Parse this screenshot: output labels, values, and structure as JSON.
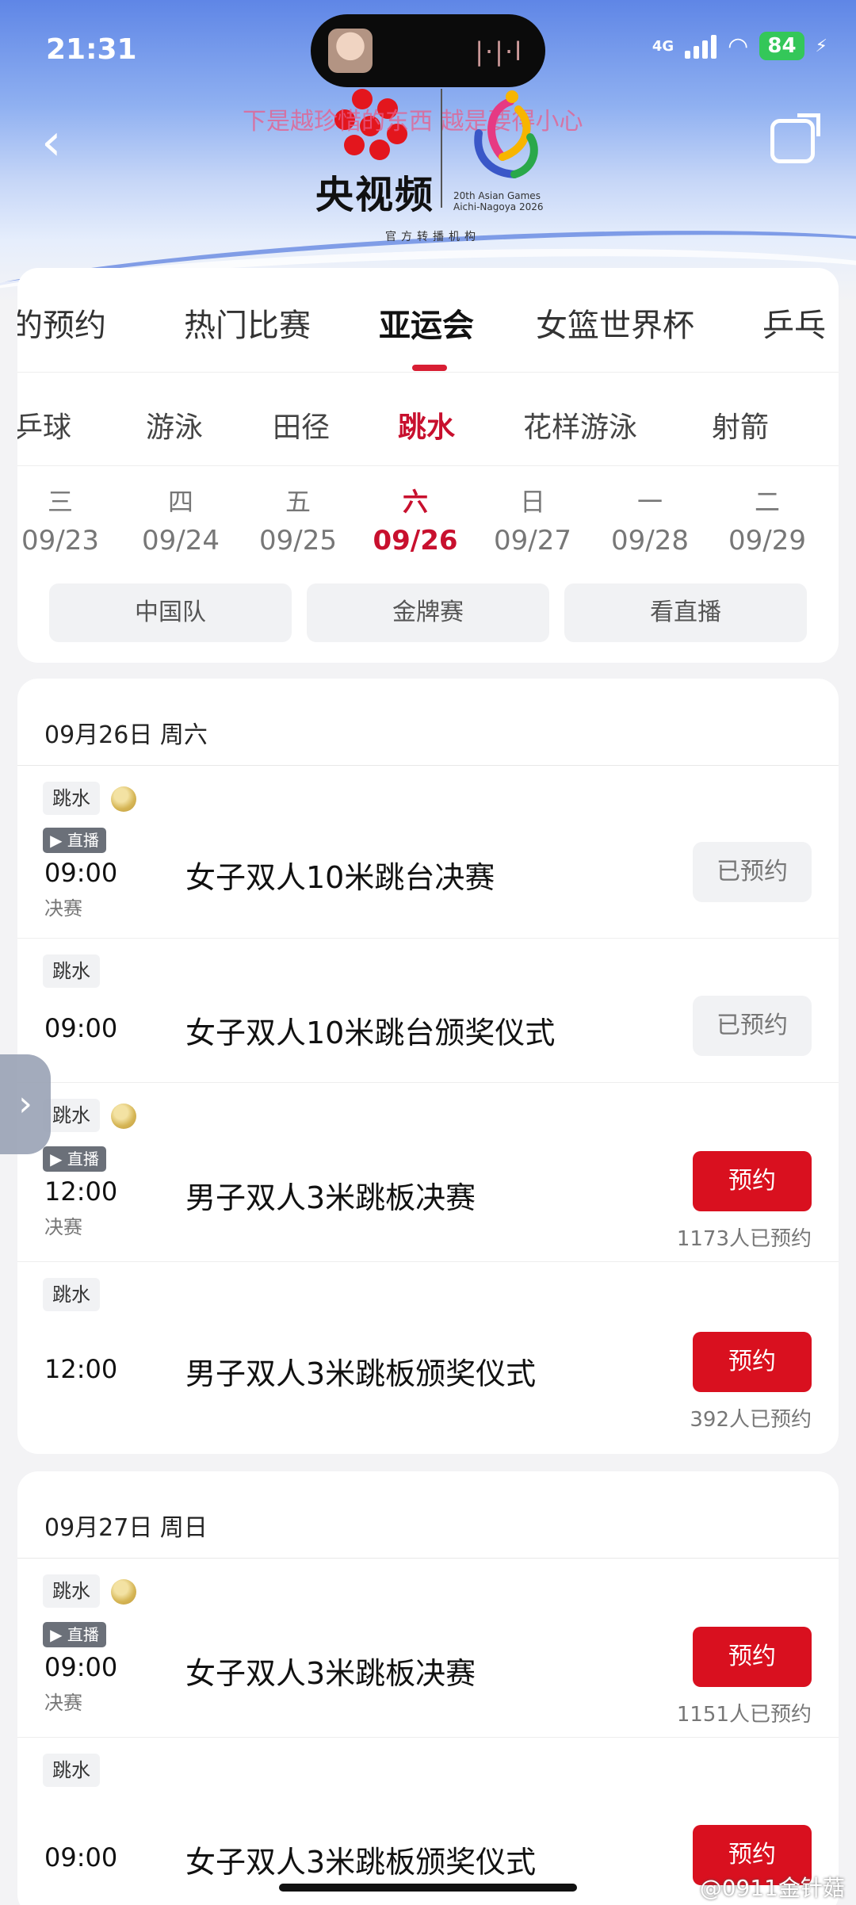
{
  "status_bar": {
    "time": "21:31",
    "network": "4G",
    "battery": "84",
    "island_bars": "|·|·l"
  },
  "header": {
    "back_icon": "chevron-left-icon",
    "share_icon": "share-icon",
    "overlay_text": "下是越珍惜的东西 越是要得小心",
    "brand_name": "央视频",
    "brand_sub": "官方转播机构",
    "games_text_line1": "20th Asian Games",
    "games_text_line2": "Aichi-Nagoya 2026"
  },
  "top_tabs": [
    {
      "label": "的预约"
    },
    {
      "label": "热门比赛"
    },
    {
      "label": "亚运会"
    },
    {
      "label": "女篮世界杯"
    },
    {
      "label": "乒乓"
    }
  ],
  "sub_tabs": [
    {
      "label": "乒球"
    },
    {
      "label": "游泳"
    },
    {
      "label": "田径"
    },
    {
      "label": "跳水"
    },
    {
      "label": "花样游泳"
    },
    {
      "label": "射箭"
    }
  ],
  "dates": [
    {
      "weekday": "三",
      "date": "09/23"
    },
    {
      "weekday": "四",
      "date": "09/24"
    },
    {
      "weekday": "五",
      "date": "09/25"
    },
    {
      "weekday": "六",
      "date": "09/26"
    },
    {
      "weekday": "日",
      "date": "09/27"
    },
    {
      "weekday": "一",
      "date": "09/28"
    },
    {
      "weekday": "二",
      "date": "09/29"
    }
  ],
  "filters": [
    {
      "label": "中国队"
    },
    {
      "label": "金牌赛"
    },
    {
      "label": "看直播"
    }
  ],
  "days": [
    {
      "heading": "09月26日 周六",
      "events": [
        {
          "tag": "跳水",
          "live": "▶ 直播",
          "time": "09:00",
          "stage": "决赛",
          "title": "女子双人10米跳台决赛",
          "button": "已预约"
        },
        {
          "tag": "跳水",
          "time": "09:00",
          "title": "女子双人10米跳台颁奖仪式",
          "button": "已预约"
        },
        {
          "tag": "跳水",
          "live": "▶ 直播",
          "time": "12:00",
          "stage": "决赛",
          "title": "男子双人3米跳板决赛",
          "button": "预约",
          "count": "1173人已预约"
        },
        {
          "tag": "跳水",
          "time": "12:00",
          "title": "男子双人3米跳板颁奖仪式",
          "button": "预约",
          "count": "392人已预约"
        }
      ]
    },
    {
      "heading": "09月27日 周日",
      "events": [
        {
          "tag": "跳水",
          "live": "▶ 直播",
          "time": "09:00",
          "stage": "决赛",
          "title": "女子双人3米跳板决赛",
          "button": "预约",
          "count": "1151人已预约"
        },
        {
          "tag": "跳水",
          "time": "09:00",
          "title": "女子双人3米跳板颁奖仪式",
          "button": "预约"
        }
      ]
    }
  ],
  "watermark": "@0911金针菇",
  "colors": {
    "accent": "#d9101f",
    "active_red": "#c8102e"
  }
}
